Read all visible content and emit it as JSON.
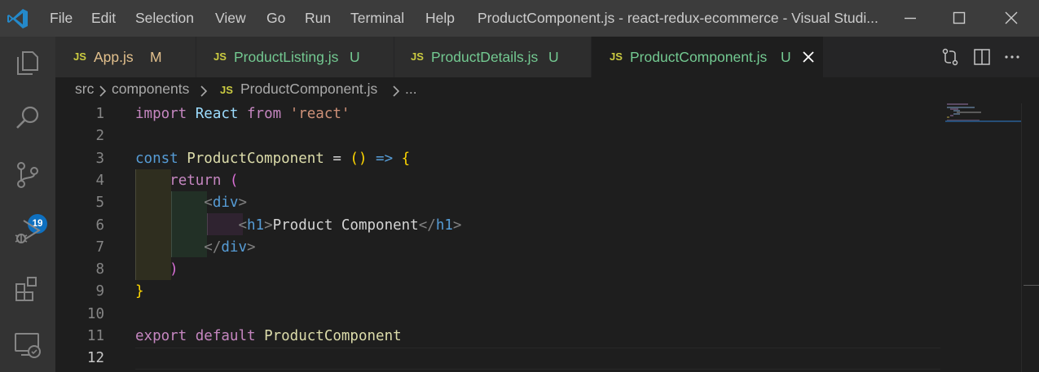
{
  "titlebar": {
    "menus": [
      "File",
      "Edit",
      "Selection",
      "View",
      "Go",
      "Run",
      "Terminal",
      "Help"
    ],
    "window_title": "ProductComponent.js - react-redux-ecommerce - Visual Studi...",
    "controls": [
      "minimize",
      "maximize",
      "close"
    ]
  },
  "activity_bar": {
    "items": [
      "explorer-icon",
      "search-icon",
      "source-control-icon",
      "run-debug-icon",
      "extensions-icon",
      "remote-explorer-icon"
    ],
    "source_control_badge": "19"
  },
  "tabs": [
    {
      "icon": "JS",
      "name": "App.js",
      "status": "M",
      "status_color": "#e2c08d",
      "name_color": "#e2c08d",
      "active": false
    },
    {
      "icon": "JS",
      "name": "ProductListing.js",
      "status": "U",
      "status_color": "#73c991",
      "name_color": "#73c991",
      "active": false
    },
    {
      "icon": "JS",
      "name": "ProductDetails.js",
      "status": "U",
      "status_color": "#73c991",
      "name_color": "#73c991",
      "active": false
    },
    {
      "icon": "JS",
      "name": "ProductComponent.js",
      "status": "U",
      "status_color": "#73c991",
      "name_color": "#73c991",
      "active": true
    }
  ],
  "tab_actions": [
    "compare-changes-icon",
    "split-editor-icon",
    "more-actions-icon"
  ],
  "breadcrumb": {
    "parts": [
      "src",
      "components"
    ],
    "file_icon": "JS",
    "file": "ProductComponent.js",
    "tail": "..."
  },
  "editor": {
    "current_line": 12,
    "line_numbers": [
      "1",
      "2",
      "3",
      "4",
      "5",
      "6",
      "7",
      "8",
      "9",
      "10",
      "11",
      "12"
    ],
    "lines": [
      [
        [
          "kw-purple",
          "import"
        ],
        [
          "txt",
          " "
        ],
        [
          "ident",
          "React"
        ],
        [
          "txt",
          " "
        ],
        [
          "kw-purple",
          "from"
        ],
        [
          "txt",
          " "
        ],
        [
          "str",
          "'react'"
        ]
      ],
      [],
      [
        [
          "kw-blue",
          "const"
        ],
        [
          "txt",
          " "
        ],
        [
          "func",
          "ProductComponent"
        ],
        [
          "txt",
          " = "
        ],
        [
          "brace-y",
          "()"
        ],
        [
          "txt",
          " "
        ],
        [
          "kw-blue",
          "=>"
        ],
        [
          "txt",
          " "
        ],
        [
          "brace-y",
          "{"
        ]
      ],
      [
        [
          "txt",
          "    "
        ],
        [
          "kw-purple",
          "return"
        ],
        [
          "txt",
          " "
        ],
        [
          "paren-p",
          "("
        ]
      ],
      [
        [
          "txt",
          "        "
        ],
        [
          "tag-br",
          "<"
        ],
        [
          "tag",
          "div"
        ],
        [
          "tag-br",
          ">"
        ]
      ],
      [
        [
          "txt",
          "            "
        ],
        [
          "tag-br",
          "<"
        ],
        [
          "tag",
          "h1"
        ],
        [
          "tag-br",
          ">"
        ],
        [
          "txt",
          "Product Component"
        ],
        [
          "tag-br",
          "</"
        ],
        [
          "tag",
          "h1"
        ],
        [
          "tag-br",
          ">"
        ]
      ],
      [
        [
          "txt",
          "        "
        ],
        [
          "tag-br",
          "</"
        ],
        [
          "tag",
          "div"
        ],
        [
          "tag-br",
          ">"
        ]
      ],
      [
        [
          "txt",
          "    "
        ],
        [
          "paren-p",
          ")"
        ]
      ],
      [
        [
          "brace-y",
          "}"
        ]
      ],
      [],
      [
        [
          "kw-purple",
          "export"
        ],
        [
          "txt",
          " "
        ],
        [
          "kw-purple",
          "default"
        ],
        [
          "txt",
          " "
        ],
        [
          "func",
          "ProductComponent"
        ]
      ],
      []
    ]
  },
  "colors": {
    "accent": "#0e70c0",
    "titlebar": "#3c3c3c",
    "activity_bar": "#333333",
    "editor_bg": "#1e1e1e"
  }
}
